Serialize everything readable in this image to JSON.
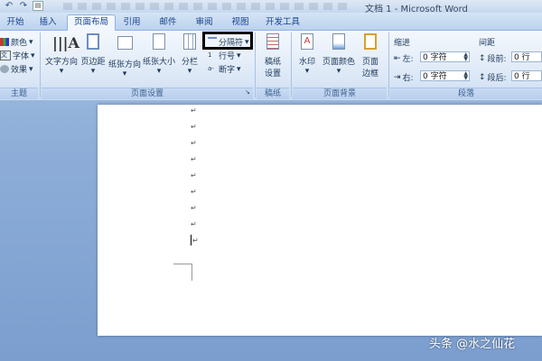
{
  "window": {
    "title": "文档 1 - Microsoft Word"
  },
  "tabs": [
    {
      "label": "开始"
    },
    {
      "label": "插入"
    },
    {
      "label": "页面布局"
    },
    {
      "label": "引用"
    },
    {
      "label": "邮件"
    },
    {
      "label": "审阅"
    },
    {
      "label": "视图"
    },
    {
      "label": "开发工具"
    }
  ],
  "theme": {
    "colors": "颜色",
    "fonts": "字体",
    "effects": "效果",
    "group": "主题"
  },
  "page_setup": {
    "text_direction": "文字方向",
    "margins": "页边距",
    "orientation": "纸张方向",
    "size": "纸张大小",
    "columns": "分栏",
    "breaks": "分隔符",
    "line_numbers": "行号",
    "hyphenation": "断字",
    "group": "页面设置"
  },
  "manuscript": {
    "label_line1": "稿纸",
    "label_line2": "设置",
    "group": "稿纸"
  },
  "page_background": {
    "watermark": "水印",
    "page_color": "页面颜色",
    "borders_line1": "页面",
    "borders_line2": "边框",
    "group": "页面背景"
  },
  "paragraph": {
    "indent_title": "缩进",
    "left_label": "左:",
    "left_value": "0 字符",
    "right_label": "右:",
    "right_value": "0 字符",
    "spacing_title": "间距",
    "before_label": "段前:",
    "before_value": "0 行",
    "after_label": "段后:",
    "after_value": "0 行",
    "group": "段落"
  },
  "document": {
    "paragraph_mark": "↵"
  },
  "overlay": {
    "watermark_text": "头条 @水之仙花"
  },
  "colors": {
    "accent": "#15428b",
    "ribbon_bg": "#dbe7f6",
    "highlight_box": "#000000"
  }
}
